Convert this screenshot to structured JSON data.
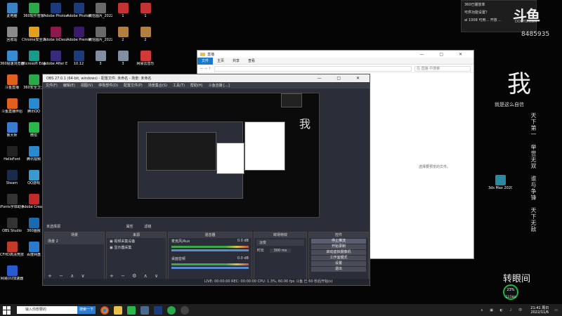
{
  "desktop": {
    "icons": [
      {
        "label": "此电脑",
        "color": "#3b82c4"
      },
      {
        "label": "360软件管家",
        "color": "#2ba84a"
      },
      {
        "label": "Adobe Photosh...",
        "color": "#1c3b7a"
      },
      {
        "label": "Adobe Photosh...",
        "color": "#1c3b7a"
      },
      {
        "label": "微信图片_2022091...",
        "color": "#6a6a6a"
      },
      {
        "label": "1",
        "color": "#c23333"
      },
      {
        "label": "1",
        "color": "#c23333"
      },
      {
        "label": "回收站",
        "color": "#8a8a8a"
      },
      {
        "label": "Chrome安全浏览器",
        "color": "#e0a020"
      },
      {
        "label": "Adobe InDesi...",
        "color": "#8a1b4a"
      },
      {
        "label": "Adobe Premie...",
        "color": "#3a1a6a"
      },
      {
        "label": "微信图片_2022091...",
        "color": "#6a6a6a"
      },
      {
        "label": "2",
        "color": "#b08040"
      },
      {
        "label": "2",
        "color": "#b08040"
      },
      {
        "label": "360极速浏览器",
        "color": "#3a8ad0"
      },
      {
        "label": "Microsoft Edge",
        "color": "#1a9a8a"
      },
      {
        "label": "Adobe After Effects 2020",
        "color": "#3a2a7a"
      },
      {
        "label": "10.12",
        "color": "#1c3b7a"
      },
      {
        "label": "3",
        "color": "#8090a0"
      },
      {
        "label": "3",
        "color": "#8090a0"
      },
      {
        "label": "网易云音乐",
        "color": "#d23a3a"
      },
      {
        "label": "斗鱼直播",
        "color": "#e06020"
      },
      {
        "label": "360安全卫士",
        "color": "#2ba84a"
      },
      {
        "label": "斗鱼直播伴侣",
        "color": "#e06020"
      },
      {
        "label": "腾讯QQ",
        "color": "#2a8ad0"
      },
      {
        "label": "鲁大师",
        "color": "#3a7ad0"
      },
      {
        "label": "微信",
        "color": "#2ab84a"
      },
      {
        "label": "HelloFont",
        "color": "#222"
      },
      {
        "label": "腾讯视频",
        "color": "#2a8ad0"
      },
      {
        "label": "Steam",
        "color": "#1a2a4a"
      },
      {
        "label": "QQ游戏",
        "color": "#3a9ad0"
      },
      {
        "label": "iFonts字体助手",
        "color": "#333"
      },
      {
        "label": "Adobe Creati...",
        "color": "#c22a2a"
      },
      {
        "label": "OBS Studio",
        "color": "#333"
      },
      {
        "label": "360画报",
        "color": "#1a6ab0"
      },
      {
        "label": "CFHD高清竞技大区",
        "color": "#c23a2a"
      },
      {
        "label": "百度网盘",
        "color": "#2a7ad0"
      },
      {
        "label": "网易UU加速器",
        "color": "#2a5ad0"
      }
    ],
    "extra_icon": {
      "label": "3ds Max 2020 - S...",
      "color": "#2a8aa0"
    }
  },
  "live_widget": {
    "line1": "360已播放率",
    "line2": "可供功能设置？",
    "line3": "al 1008 可用... 开放 ...",
    "logo": "斗鱼",
    "logo_sub": "DOUYU.COM",
    "room_id": "8485935"
  },
  "overlay": {
    "big_char": "我",
    "sub_line": "就是这么自信",
    "col1": "天下第一",
    "col2": "举世无双",
    "col3": "谁与争锋",
    "col4": "天下无敌",
    "bottom": "转眼间",
    "badge_value": "23%",
    "badge_sub": "13.5k/s"
  },
  "explorer": {
    "title": "直播",
    "tabs": [
      "文件",
      "主页",
      "共享",
      "查看"
    ],
    "search_placeholder": "在 直播 中搜索",
    "empty_message": "选择要预览的文件。"
  },
  "obs": {
    "title": "OBS 27.0.1 (64-bit, windows) - 配置文件: 未命名 - 场景: 未命名",
    "menu": [
      "文件(F)",
      "编辑(E)",
      "视图(V)",
      "停靠部件(D)",
      "配置文件(P)",
      "场景集合(S)",
      "工具(T)",
      "帮助(H)",
      "斗鱼自播 [...]"
    ],
    "no_source": "未选择源",
    "filters_label": "属性",
    "filters_label2": "滤镜",
    "scenes_header": "场景",
    "scene_item": "场景 2",
    "sources_header": "来源",
    "sources": [
      "视频采集设备",
      "显示器采集"
    ],
    "mixer_header": "混音器",
    "mixer_items": [
      {
        "name": "麦克风/Aux",
        "db": "0.0 dB"
      },
      {
        "name": "桌面音频",
        "db": "0.0 dB"
      }
    ],
    "transitions_header": "转场特效",
    "transition_type": "淡变",
    "duration_label": "时长",
    "duration_value": "300 ms",
    "controls_header": "控件",
    "controls": [
      "停止推流",
      "开始录制",
      "启动虚拟摄像机",
      "工作室模式",
      "设置",
      "退出"
    ],
    "status": "LIVE: 00:00:00   REC: 00:00:00   CPU: 1.3%, 60.00 fps   斗鱼 已 60 秒后开始(s)"
  },
  "taskbar": {
    "search_placeholder": "输入你想要的",
    "next_button": "搜索一下",
    "time": "21:41 周日",
    "date": "2022/11/6"
  }
}
